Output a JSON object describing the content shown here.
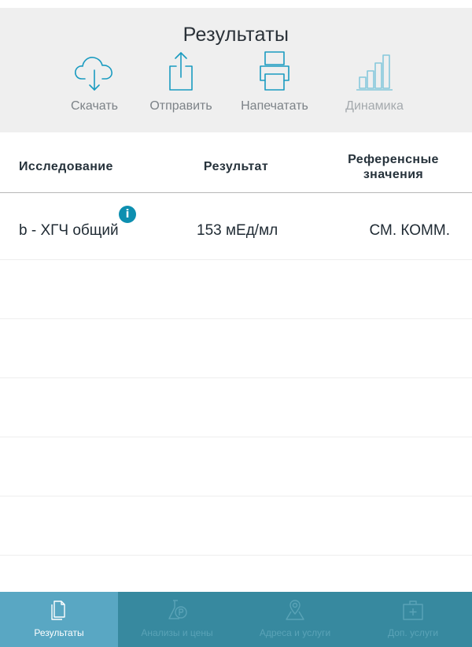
{
  "header": {
    "title": "Результаты",
    "actions": [
      {
        "label": "Скачать",
        "icon": "cloud-download-icon",
        "enabled": true
      },
      {
        "label": "Отправить",
        "icon": "share-icon",
        "enabled": true
      },
      {
        "label": "Напечатать",
        "icon": "printer-icon",
        "enabled": true
      },
      {
        "label": "Динамика",
        "icon": "bar-chart-icon",
        "enabled": false
      }
    ]
  },
  "table": {
    "columns": [
      "Исследование",
      "Результат",
      "Референсные значения"
    ],
    "rows": [
      {
        "name": "b - ХГЧ общий",
        "value": "153 мЕд/мл",
        "reference": "СМ. КОММ.",
        "has_info": true
      }
    ],
    "info_badge": "i"
  },
  "tabbar": {
    "tabs": [
      {
        "label": "Результаты",
        "icon": "document-icon",
        "active": true
      },
      {
        "label": "Анализы и цены",
        "icon": "flask-price-icon",
        "active": false
      },
      {
        "label": "Адреса и услуги",
        "icon": "map-pin-icon",
        "active": false
      },
      {
        "label": "Доп. услуги",
        "icon": "medical-kit-icon",
        "active": false
      }
    ]
  },
  "colors": {
    "accent": "#0d8fb0",
    "header_bg": "#efefef",
    "tabbar_bg": "#37899f",
    "tab_active_bg": "#59a7c3",
    "icon_blue": "#1a9bc0",
    "icon_disabled": "#86c9dc"
  }
}
